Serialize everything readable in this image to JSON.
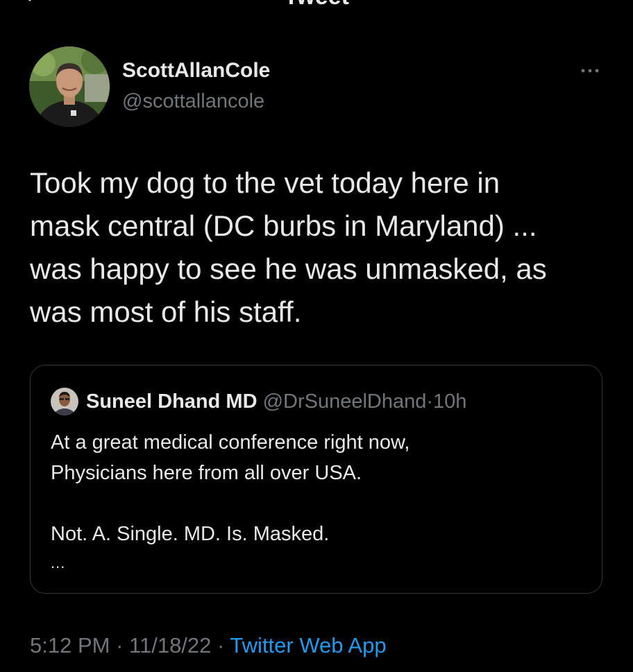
{
  "header": {
    "title": "Tweet",
    "back_icon": "arrow-left-icon"
  },
  "author": {
    "display_name": "ScottAllanCole",
    "handle": "@scottallancole",
    "more_icon": "more-horizontal-icon"
  },
  "tweet": {
    "lines": [
      "Took my dog to the vet today here in",
      "mask central (DC burbs in Maryland) ...",
      "was happy to see he was unmasked, as",
      "was most of his staff."
    ]
  },
  "quoted_tweet": {
    "display_name": "Suneel Dhand MD",
    "handle": "@DrSuneelDhand",
    "separator": "·",
    "time": "10h",
    "lines": [
      "At a great medical conference right now,",
      "Physicians here from all over USA.",
      "",
      "Not. A. Single. MD. Is. Masked."
    ],
    "truncation": "..."
  },
  "meta": {
    "time": "5:12 PM",
    "sep1": "·",
    "date": "11/18/22",
    "sep2": "·",
    "source": "Twitter Web App"
  },
  "colors": {
    "background": "#000000",
    "text_primary": "#e7e9ea",
    "text_secondary": "#71767b",
    "link": "#1d9bf0",
    "border": "#333639"
  }
}
